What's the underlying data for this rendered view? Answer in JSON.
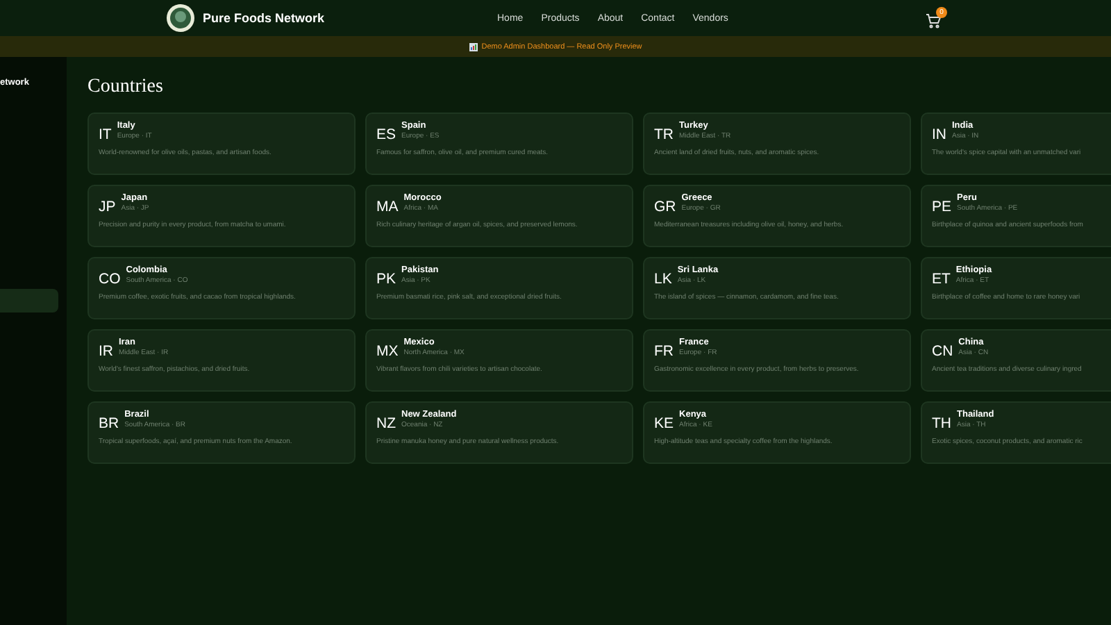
{
  "header": {
    "brand": "Pure Foods Network",
    "nav": [
      "Home",
      "Products",
      "About",
      "Contact",
      "Vendors"
    ],
    "cart_count": "0"
  },
  "banner": {
    "text": "Demo Admin Dashboard — Read Only Preview"
  },
  "sidebar": {
    "title": "etwork"
  },
  "page": {
    "title": "Countries"
  },
  "countries": [
    {
      "code": "IT",
      "name": "Italy",
      "region": "Europe · IT",
      "description": "World-renowned for olive oils, pastas, and artisan foods."
    },
    {
      "code": "ES",
      "name": "Spain",
      "region": "Europe · ES",
      "description": "Famous for saffron, olive oil, and premium cured meats."
    },
    {
      "code": "TR",
      "name": "Turkey",
      "region": "Middle East · TR",
      "description": "Ancient land of dried fruits, nuts, and aromatic spices."
    },
    {
      "code": "IN",
      "name": "India",
      "region": "Asia · IN",
      "description": "The world's spice capital with an unmatched vari"
    },
    {
      "code": "JP",
      "name": "Japan",
      "region": "Asia · JP",
      "description": "Precision and purity in every product, from matcha to umami."
    },
    {
      "code": "MA",
      "name": "Morocco",
      "region": "Africa · MA",
      "description": "Rich culinary heritage of argan oil, spices, and preserved lemons."
    },
    {
      "code": "GR",
      "name": "Greece",
      "region": "Europe · GR",
      "description": "Mediterranean treasures including olive oil, honey, and herbs."
    },
    {
      "code": "PE",
      "name": "Peru",
      "region": "South America · PE",
      "description": "Birthplace of quinoa and ancient superfoods from"
    },
    {
      "code": "CO",
      "name": "Colombia",
      "region": "South America · CO",
      "description": "Premium coffee, exotic fruits, and cacao from tropical highlands."
    },
    {
      "code": "PK",
      "name": "Pakistan",
      "region": "Asia · PK",
      "description": "Premium basmati rice, pink salt, and exceptional dried fruits."
    },
    {
      "code": "LK",
      "name": "Sri Lanka",
      "region": "Asia · LK",
      "description": "The island of spices — cinnamon, cardamom, and fine teas."
    },
    {
      "code": "ET",
      "name": "Ethiopia",
      "region": "Africa · ET",
      "description": "Birthplace of coffee and home to rare honey vari"
    },
    {
      "code": "IR",
      "name": "Iran",
      "region": "Middle East · IR",
      "description": "World's finest saffron, pistachios, and dried fruits."
    },
    {
      "code": "MX",
      "name": "Mexico",
      "region": "North America · MX",
      "description": "Vibrant flavors from chili varieties to artisan chocolate."
    },
    {
      "code": "FR",
      "name": "France",
      "region": "Europe · FR",
      "description": "Gastronomic excellence in every product, from herbs to preserves."
    },
    {
      "code": "CN",
      "name": "China",
      "region": "Asia · CN",
      "description": "Ancient tea traditions and diverse culinary ingred"
    },
    {
      "code": "BR",
      "name": "Brazil",
      "region": "South America · BR",
      "description": "Tropical superfoods, açaí, and premium nuts from the Amazon."
    },
    {
      "code": "NZ",
      "name": "New Zealand",
      "region": "Oceania · NZ",
      "description": "Pristine manuka honey and pure natural wellness products."
    },
    {
      "code": "KE",
      "name": "Kenya",
      "region": "Africa · KE",
      "description": "High-altitude teas and specialty coffee from the highlands."
    },
    {
      "code": "TH",
      "name": "Thailand",
      "region": "Asia · TH",
      "description": "Exotic spices, coconut products, and aromatic ric"
    }
  ]
}
